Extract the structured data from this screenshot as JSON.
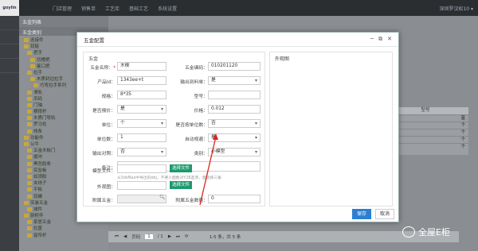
{
  "topnav": {
    "logo": "goylin",
    "items": [
      "门店管理",
      "销售单",
      "工艺库",
      "基础工艺",
      "系统设置"
    ],
    "user": "深圳罗汉松10 ▾"
  },
  "tree": {
    "title": "五金列表",
    "category_label": "五金类别",
    "items": [
      "连接件",
      "铰链",
      "把手",
      "切槽把",
      "鉴口把",
      "拉手",
      "木质封边拉手",
      "巧弯拉手系列",
      "滑轨",
      "吊码",
      "门轴",
      "横撑杆",
      "木质门导轨",
      "罗马柱",
      "线条",
      "功能件",
      "公牛",
      "五金木板门",
      "缓冲",
      "黑色胶条",
      "实验板",
      "如须胶",
      "夹线子",
      "平板",
      "铰螺",
      "安装五金",
      "减件",
      "厨柜件",
      "家居五金",
      "拉篮",
      "窗帘杆"
    ]
  },
  "grid": {
    "header": "型号",
    "rows": [
      "富",
      "个",
      "个",
      "个",
      "个"
    ]
  },
  "pager": {
    "page_label": "页码",
    "page": "1",
    "of": "/ 1",
    "summary": "1-5 条，共 5 条"
  },
  "dialog": {
    "title": "五金配置",
    "ctrl_min": "─",
    "ctrl_max": "⧉",
    "ctrl_close": "✕",
    "section_left": "五金",
    "section_right": "外观图",
    "fields": {
      "name_label": "五金名称：",
      "name_value": "木楔",
      "code_label": "五金编码：",
      "code_value": "010201120",
      "product_id_label": "产品Id：",
      "product_id_value": "1343ee+t",
      "output_material_label": "输出到料单：",
      "output_material_value": "是",
      "spec_label": "规格：",
      "spec_value": "8*35",
      "model_label": "型号：",
      "model_value": "",
      "quote_label": "是否报价：",
      "quote_value": "是",
      "price_label": "价格：",
      "price_value": "0.012",
      "unit_label": "单位：",
      "unit_value": "个",
      "by_unit_label": "是否按单位数：",
      "by_unit_value": "否",
      "unit_count_label": "单位数：",
      "unit_count_value": "1",
      "auto_plan_label": "自动规避：",
      "auto_plan_value": "是",
      "output_label": "输出对照：",
      "output_value": "否",
      "category_label": "类别：",
      "category_value": "小模型",
      "note_label": "备注：",
      "note_value": "",
      "model_file_label": "模型文件：",
      "model_file_value": "",
      "model_file_button": "选择文件",
      "model_file_hint": "从3dsMax中导出的obj，不要小面数对Y28选项，面选择三角",
      "appearance_label": "外观图：",
      "appearance_value": "",
      "appearance_button": "选择文件",
      "attached_label": "附属五金：",
      "attached_value": "",
      "attached_count_label": "附属五金数量：",
      "attached_count_value": "0"
    },
    "save_button": "保存",
    "cancel_button": "取消"
  },
  "watermark": "全屋E柜"
}
